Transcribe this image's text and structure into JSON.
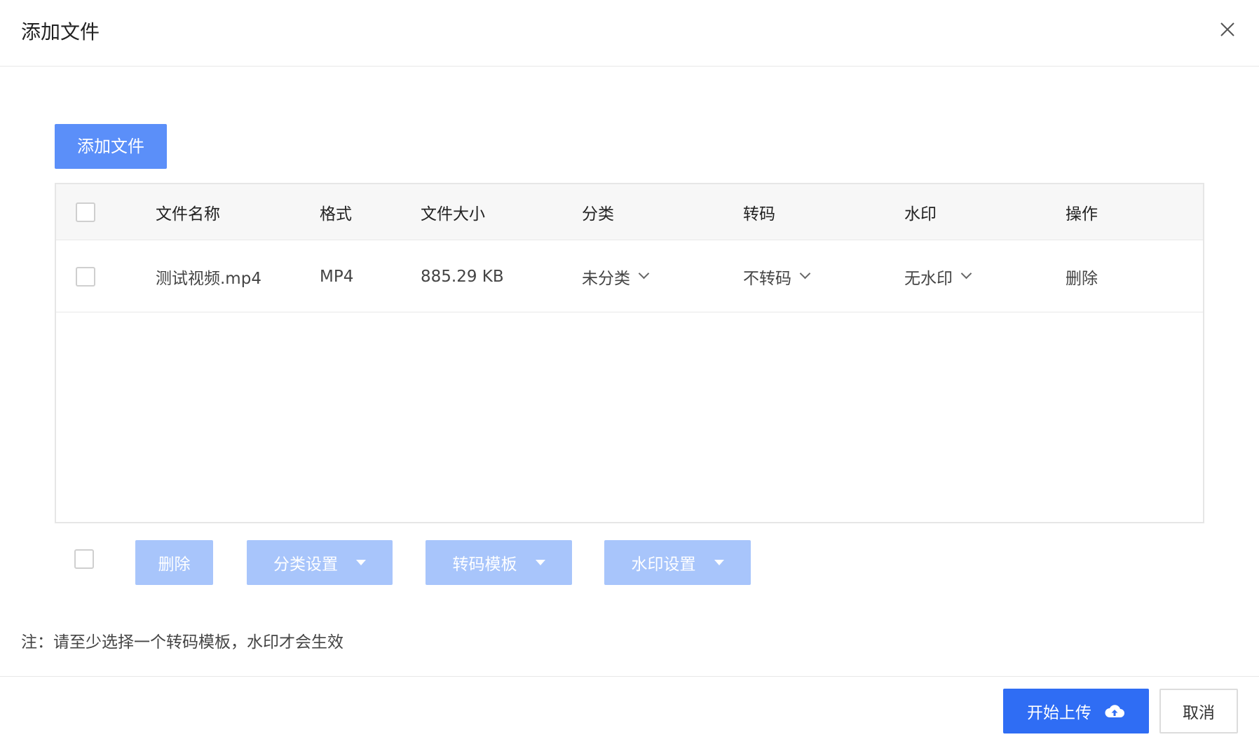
{
  "dialog": {
    "title": "添加文件",
    "close_icon": "close-icon"
  },
  "toolbar": {
    "add_file_label": "添加文件"
  },
  "table": {
    "columns": [
      "文件名称",
      "格式",
      "文件大小",
      "分类",
      "转码",
      "水印",
      "操作"
    ],
    "rows": [
      {
        "name": "测试视频.mp4",
        "format": "MP4",
        "size": "885.29 KB",
        "category": "未分类",
        "transcode": "不转码",
        "watermark": "无水印",
        "action": "删除"
      }
    ]
  },
  "bulk_actions": {
    "delete_label": "删除",
    "category_label": "分类设置",
    "transcode_label": "转码模板",
    "watermark_label": "水印设置"
  },
  "note": "注：请至少选择一个转码模板，水印才会生效",
  "footer": {
    "upload_label": "开始上传",
    "upload_icon": "cloud-upload-icon",
    "cancel_label": "取消"
  },
  "colors": {
    "primary": "#2f6df4",
    "primary_light": "#5b8ff9",
    "disabled": "#a8c5fb",
    "link": "#3b73e8"
  }
}
